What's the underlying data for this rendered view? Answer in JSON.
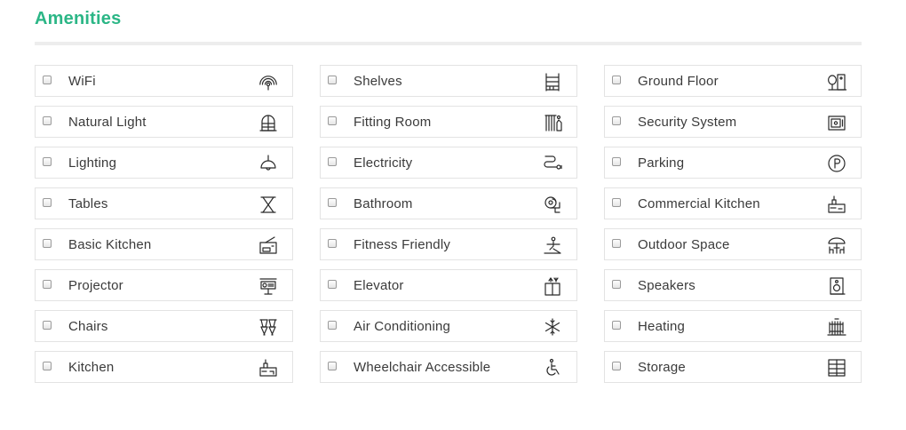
{
  "section": {
    "title": "Amenities",
    "accent_color": "#2bb686"
  },
  "amenities": [
    {
      "label": "WiFi",
      "icon": "wifi-icon",
      "checked": false
    },
    {
      "label": "Shelves",
      "icon": "shelves-icon",
      "checked": false
    },
    {
      "label": "Ground Floor",
      "icon": "ground-floor-icon",
      "checked": false
    },
    {
      "label": "Natural Light",
      "icon": "window-icon",
      "checked": false
    },
    {
      "label": "Fitting Room",
      "icon": "fitting-room-icon",
      "checked": false
    },
    {
      "label": "Security System",
      "icon": "safe-icon",
      "checked": false
    },
    {
      "label": "Lighting",
      "icon": "lamp-icon",
      "checked": false
    },
    {
      "label": "Electricity",
      "icon": "plug-icon",
      "checked": false
    },
    {
      "label": "Parking",
      "icon": "parking-icon",
      "checked": false
    },
    {
      "label": "Tables",
      "icon": "table-icon",
      "checked": false
    },
    {
      "label": "Bathroom",
      "icon": "toilet-paper-icon",
      "checked": false
    },
    {
      "label": "Commercial Kitchen",
      "icon": "commercial-kitchen-icon",
      "checked": false
    },
    {
      "label": "Basic Kitchen",
      "icon": "basic-kitchen-icon",
      "checked": false
    },
    {
      "label": "Fitness Friendly",
      "icon": "fitness-icon",
      "checked": false
    },
    {
      "label": "Outdoor Space",
      "icon": "outdoor-umbrella-icon",
      "checked": false
    },
    {
      "label": "Projector",
      "icon": "projector-icon",
      "checked": false
    },
    {
      "label": "Elevator",
      "icon": "elevator-icon",
      "checked": false
    },
    {
      "label": "Speakers",
      "icon": "speaker-icon",
      "checked": false
    },
    {
      "label": "Chairs",
      "icon": "chairs-icon",
      "checked": false
    },
    {
      "label": "Air Conditioning",
      "icon": "snowflake-icon",
      "checked": false
    },
    {
      "label": "Heating",
      "icon": "radiator-icon",
      "checked": false
    },
    {
      "label": "Kitchen",
      "icon": "kitchen-icon",
      "checked": false
    },
    {
      "label": "Wheelchair Accessible",
      "icon": "wheelchair-icon",
      "checked": false
    },
    {
      "label": "Storage",
      "icon": "storage-cabinet-icon",
      "checked": false
    }
  ]
}
